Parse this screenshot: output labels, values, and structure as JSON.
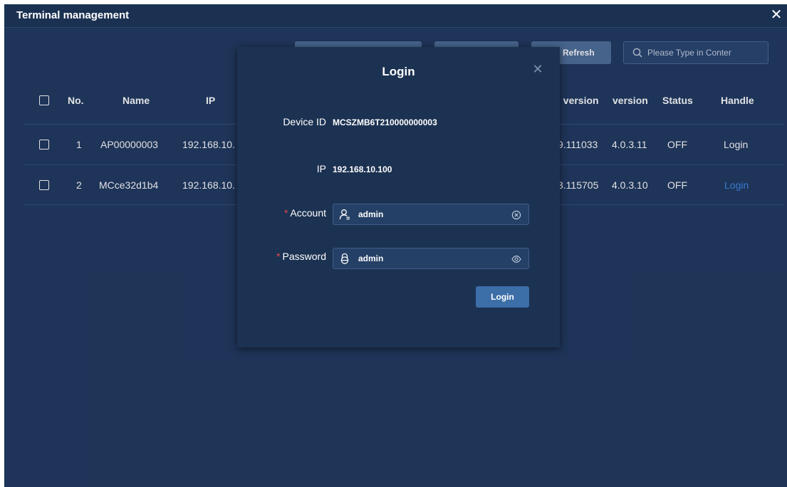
{
  "window": {
    "title": "Terminal management",
    "close_icon": "close-icon"
  },
  "toolbar": {
    "refresh_label": "Refresh",
    "search_placeholder": "Please Type in Conter",
    "search_icon": "search-icon"
  },
  "table": {
    "headers": {
      "no": "No.",
      "name": "Name",
      "ip": "IP",
      "firmware_version": "l version",
      "version": "version",
      "status": "Status",
      "handle": "Handle"
    },
    "rows": [
      {
        "no": "1",
        "name": "AP00000003",
        "ip": "192.168.10.",
        "firmware_version": "9.111033",
        "version": "4.0.3.11",
        "status": "OFF",
        "handle": "Login"
      },
      {
        "no": "2",
        "name": "MCce32d1b4",
        "ip": "192.168.10.",
        "firmware_version": "3.115705",
        "version": "4.0.3.10",
        "status": "OFF",
        "handle": "Login"
      }
    ]
  },
  "login_modal": {
    "title": "Login",
    "device_id_label": "Device ID",
    "device_id_value": "MCSZMB6T210000000003",
    "ip_label": "IP",
    "ip_value": "192.168.10.100",
    "required_mark": "*",
    "account_label": "Account",
    "account_value": "admin",
    "password_label": "Password",
    "password_value": "admin",
    "login_button": "Login"
  },
  "colors": {
    "window_bg": "#223a5f",
    "titlebar_bg": "#1b3152",
    "modal_bg": "#1c3252",
    "button_bg": "#4f6f99",
    "primary_button": "#3c6ea8",
    "link": "#3f8ae8",
    "required": "#e0494b"
  }
}
